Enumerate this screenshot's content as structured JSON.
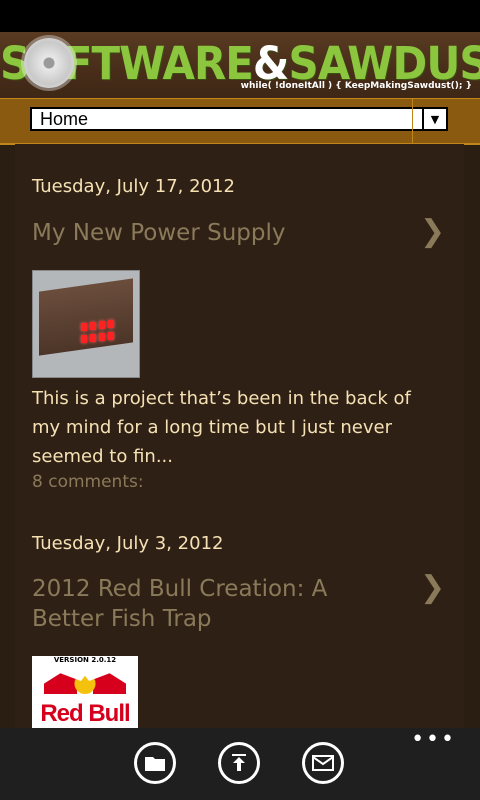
{
  "banner": {
    "title_left": "S",
    "title_mid": "FTWARE",
    "title_amp": "&",
    "title_right": "SAWDUST",
    "tagline": "while( !doneItAll ) { KeepMakingSawdust(); }"
  },
  "nav": {
    "selected": "Home"
  },
  "posts": [
    {
      "date": "Tuesday, July 17, 2012",
      "title": "My New Power Supply",
      "excerpt": "This is a project that’s been in the back of my mind for a long time but I just never seemed to fin...",
      "comments": "8 comments:"
    },
    {
      "date": "Tuesday, July 3, 2012",
      "title": "2012 Red Bull Creation: A Better Fish Trap",
      "thumb_version": "VERSION 2.0.12",
      "thumb_logo": "Red Bull"
    }
  ],
  "app_bar": {
    "buttons": [
      "folder-icon",
      "upload-icon",
      "mail-icon"
    ],
    "more": "•••"
  },
  "colors": {
    "background": "#2a1e12",
    "accent": "#8cc63f",
    "nav": "#8a5a10",
    "text": "#f6e1b4",
    "muted": "#8a7a5a"
  }
}
